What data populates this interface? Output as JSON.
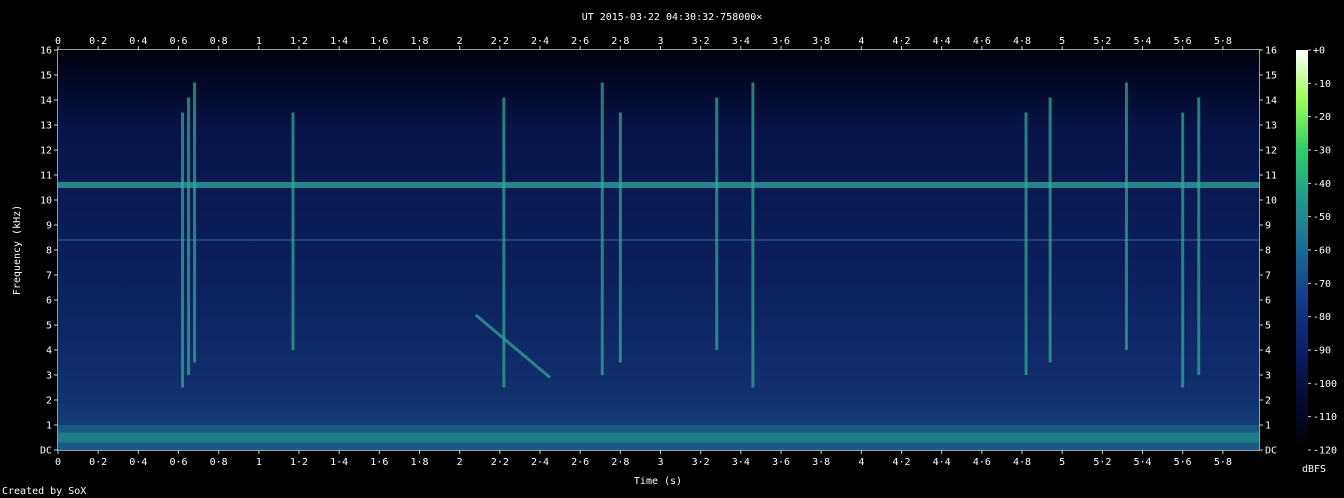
{
  "chart_data": {
    "type": "heatmap",
    "title": "UT 2015-03-22 04:30:32·758000×",
    "xlabel": "Time (s)",
    "ylabel": "Frequency (kHz)",
    "footer": "Created by SoX",
    "colorbar_label": "dBFS",
    "xlim": [
      0,
      5.98
    ],
    "ylim": [
      0,
      16
    ],
    "x_ticks": [
      "0",
      "0·2",
      "0·4",
      "0·6",
      "0·8",
      "1",
      "1·2",
      "1·4",
      "1·6",
      "1·8",
      "2",
      "2·2",
      "2·4",
      "2·6",
      "2·8",
      "3",
      "3·2",
      "3·4",
      "3·6",
      "3·8",
      "4",
      "4·2",
      "4·4",
      "4·6",
      "4·8",
      "5",
      "5·2",
      "5·4",
      "5·6",
      "5·8"
    ],
    "x_tick_values": [
      0,
      0.2,
      0.4,
      0.6,
      0.8,
      1,
      1.2,
      1.4,
      1.6,
      1.8,
      2,
      2.2,
      2.4,
      2.6,
      2.8,
      3,
      3.2,
      3.4,
      3.6,
      3.8,
      4,
      4.2,
      4.4,
      4.6,
      4.8,
      5,
      5.2,
      5.4,
      5.6,
      5.8
    ],
    "y_ticks": [
      "DC",
      "1",
      "2",
      "3",
      "4",
      "5",
      "6",
      "7",
      "8",
      "9",
      "10",
      "11",
      "12",
      "13",
      "14",
      "15",
      "16"
    ],
    "y_tick_values": [
      0,
      1,
      2,
      3,
      4,
      5,
      6,
      7,
      8,
      9,
      10,
      11,
      12,
      13,
      14,
      15,
      16
    ],
    "colorbar_ticks": [
      "+0",
      "-10",
      "-20",
      "-30",
      "-40",
      "-50",
      "-60",
      "-70",
      "-80",
      "-90",
      "-100",
      "-110",
      "-120"
    ],
    "colorbar_values": [
      0,
      -10,
      -20,
      -30,
      -40,
      -50,
      -60,
      -70,
      -80,
      -90,
      -100,
      -110,
      -120
    ],
    "colorbar_range": [
      -120,
      0
    ],
    "colormap": [
      "#000000",
      "#080a30",
      "#0e1c6a",
      "#143a8a",
      "#1b6a98",
      "#1f9a8c",
      "#2ad06a",
      "#9aff50",
      "#ffffff"
    ],
    "features": {
      "horizontal_band_khz": 10.6,
      "secondary_band_khz": 8.4,
      "low_band_khz": [
        0,
        1
      ],
      "vertical_streaks_s": [
        0.62,
        0.65,
        0.68,
        1.17,
        2.22,
        2.71,
        2.8,
        3.28,
        3.46,
        4.82,
        4.94,
        5.32,
        5.6,
        5.68
      ],
      "sweep": {
        "start_s": 2.08,
        "start_khz": 5.4,
        "end_s": 2.45,
        "end_khz": 2.9
      }
    }
  }
}
